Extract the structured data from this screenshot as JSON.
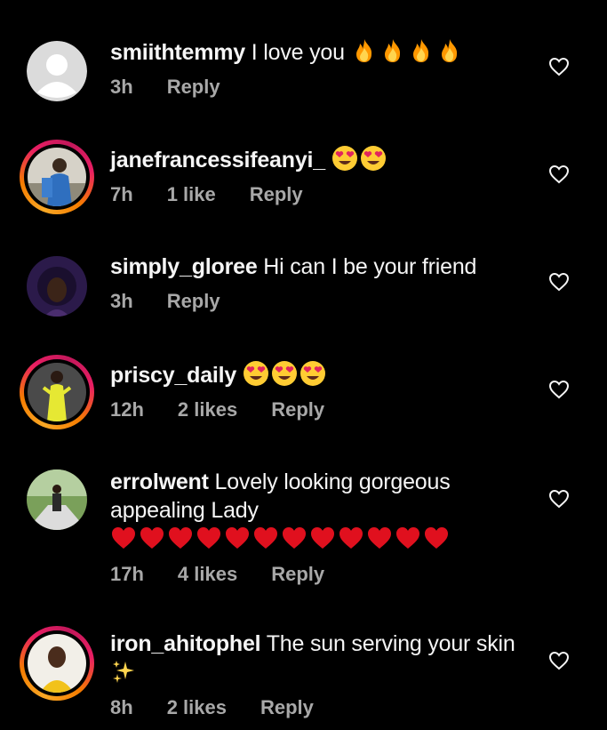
{
  "colors": {
    "background": "#000000",
    "text": "#f5f5f5",
    "meta": "#a8a8a8",
    "story_ring": [
      "#f9a825",
      "#e91e63"
    ]
  },
  "comments": [
    {
      "username": "smiithtemmy",
      "text": "I love you",
      "emojis": [
        "fire-emoji",
        "fire-emoji",
        "fire-emoji",
        "fire-emoji"
      ],
      "time": "3h",
      "likes": "",
      "reply": "Reply",
      "avatar": "default-avatar-icon",
      "story_ring": false
    },
    {
      "username": "janefrancessifeanyi_",
      "text": "",
      "emojis": [
        "heart-eyes-emoji",
        "heart-eyes-emoji"
      ],
      "time": "7h",
      "likes": "1 like",
      "reply": "Reply",
      "avatar": "user-photo",
      "story_ring": true
    },
    {
      "username": "simply_gloree",
      "text": "Hi can I be your friend",
      "emojis": [],
      "time": "3h",
      "likes": "",
      "reply": "Reply",
      "avatar": "user-photo",
      "story_ring": false
    },
    {
      "username": "priscy_daily",
      "text": "",
      "emojis": [
        "heart-eyes-emoji",
        "heart-eyes-emoji",
        "heart-eyes-emoji"
      ],
      "time": "12h",
      "likes": "2 likes",
      "reply": "Reply",
      "avatar": "user-photo",
      "story_ring": true
    },
    {
      "username": "errolwent",
      "text": "Lovely looking gorgeous appealing Lady",
      "emojis": [
        "red-heart-emoji",
        "red-heart-emoji",
        "red-heart-emoji",
        "red-heart-emoji",
        "red-heart-emoji",
        "red-heart-emoji",
        "red-heart-emoji",
        "red-heart-emoji",
        "red-heart-emoji",
        "red-heart-emoji",
        "red-heart-emoji",
        "red-heart-emoji"
      ],
      "time": "17h",
      "likes": "4 likes",
      "reply": "Reply",
      "avatar": "user-photo",
      "story_ring": false
    },
    {
      "username": "iron_ahitophel",
      "text": "The sun serving your skin",
      "emojis": [
        "sparkles-emoji"
      ],
      "time": "8h",
      "likes": "2 likes",
      "reply": "Reply",
      "avatar": "user-photo",
      "story_ring": true
    }
  ]
}
